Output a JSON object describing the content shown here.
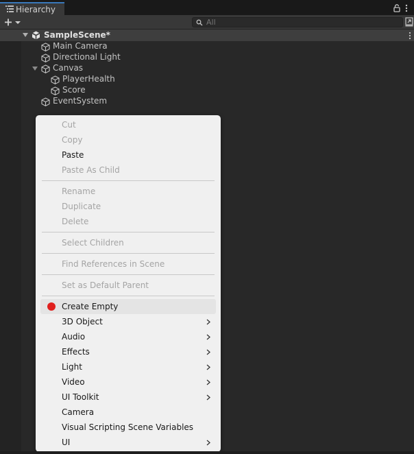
{
  "window": {
    "tab_label": "Hierarchy"
  },
  "toolbar": {
    "search_placeholder": "All"
  },
  "scene": {
    "name": "SampleScene*"
  },
  "tree": {
    "main_camera": "Main Camera",
    "directional_light": "Directional Light",
    "canvas": "Canvas",
    "player_health": "PlayerHealth",
    "score": "Score",
    "event_system": "EventSystem"
  },
  "menu": {
    "cut": "Cut",
    "copy": "Copy",
    "paste": "Paste",
    "paste_as_child": "Paste As Child",
    "rename": "Rename",
    "duplicate": "Duplicate",
    "delete": "Delete",
    "select_children": "Select Children",
    "find_references": "Find References in Scene",
    "set_default_parent": "Set as Default Parent",
    "create_empty": "Create Empty",
    "object_3d": "3D Object",
    "audio": "Audio",
    "effects": "Effects",
    "light": "Light",
    "video": "Video",
    "ui_toolkit": "UI Toolkit",
    "camera": "Camera",
    "visual_scripting": "Visual Scripting Scene Variables",
    "ui": "UI"
  },
  "colors": {
    "accent": "#3a79bb",
    "panel": "#282828",
    "menu_bg": "#f0f0f0",
    "highlight_dot": "#e0201e"
  }
}
